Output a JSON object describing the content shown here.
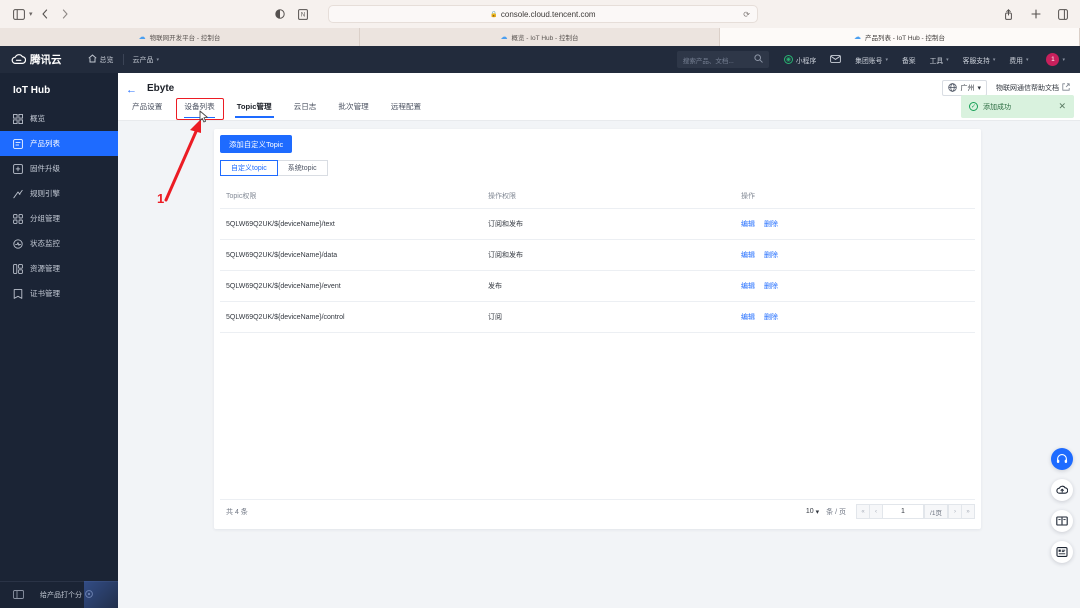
{
  "browser": {
    "url": "console.cloud.tencent.com",
    "lock_icon": "lock-icon",
    "reload_icon": "reload-icon",
    "sidebar_toggle_icon": "sidebar-toggle-icon",
    "back_icon": "back-icon",
    "forward_icon": "forward-icon",
    "reader_icon": "reader-icon",
    "extension_icon": "notion-extension-icon",
    "share_icon": "share-icon",
    "newtab_icon": "new-tab-icon",
    "tabs_icon": "show-tabs-icon",
    "tabs": [
      {
        "title": "物联网开发平台 - 控制台",
        "active": false
      },
      {
        "title": "概览 - IoT Hub - 控制台",
        "active": false
      },
      {
        "title": "产品列表 - IoT Hub - 控制台",
        "active": true
      }
    ]
  },
  "tc_header": {
    "logo_text": "腾讯云",
    "nav": [
      {
        "label": "总览",
        "icon": "home-icon",
        "caret": false
      },
      {
        "label": "云产品",
        "icon": "",
        "caret": true
      }
    ],
    "search_placeholder": "搜索产品、文档...",
    "right_items": [
      {
        "label": "小程序",
        "icon": "miniprogram-icon",
        "caret": false
      },
      {
        "label": "",
        "icon": "mail-icon",
        "caret": false
      },
      {
        "label": "集团账号",
        "icon": "",
        "caret": true
      },
      {
        "label": "备案",
        "icon": "",
        "caret": false
      },
      {
        "label": "工具",
        "icon": "",
        "caret": true
      },
      {
        "label": "客服支持",
        "icon": "",
        "caret": true
      },
      {
        "label": "费用",
        "icon": "",
        "caret": true
      }
    ],
    "avatar_text": "1"
  },
  "sidebar": {
    "title": "IoT Hub",
    "items": [
      {
        "label": "概览",
        "icon": "grid-icon",
        "active": false
      },
      {
        "label": "产品列表",
        "icon": "product-list-icon",
        "active": true
      },
      {
        "label": "固件升级",
        "icon": "firmware-upgrade-icon",
        "active": false
      },
      {
        "label": "规则引擎",
        "icon": "rule-engine-icon",
        "active": false
      },
      {
        "label": "分组管理",
        "icon": "group-manage-icon",
        "active": false
      },
      {
        "label": "状态监控",
        "icon": "status-monitor-icon",
        "active": false
      },
      {
        "label": "资源管理",
        "icon": "resource-manage-icon",
        "active": false
      },
      {
        "label": "证书管理",
        "icon": "certificate-icon",
        "active": false
      }
    ],
    "footer": {
      "collapse_icon": "collapse-icon",
      "rate_label": "给产品打个分",
      "rate_icon": "star-circle-icon"
    }
  },
  "page": {
    "back_icon": "back-arrow-icon",
    "title": "Ebyte",
    "tabs": [
      {
        "label": "产品设置",
        "state": "normal"
      },
      {
        "label": "设备列表",
        "state": "hovered"
      },
      {
        "label": "Topic管理",
        "state": "active"
      },
      {
        "label": "云日志",
        "state": "normal"
      },
      {
        "label": "批次管理",
        "state": "normal"
      },
      {
        "label": "远程配置",
        "state": "normal"
      }
    ],
    "region": {
      "label": "广州",
      "icon": "globe-icon",
      "caret": "▾"
    },
    "help_link": "物联网通信帮助文档",
    "help_external_icon": "external-link-icon"
  },
  "toast": {
    "icon": "success-check-icon",
    "message": "添加成功",
    "close_icon": "close-icon"
  },
  "panel": {
    "add_button": "添加自定义Topic",
    "segments": [
      {
        "label": "自定义topic",
        "active": true
      },
      {
        "label": "系统topic",
        "active": false
      }
    ],
    "columns": [
      "Topic权限",
      "操作权限",
      "操作"
    ],
    "rows": [
      {
        "topic": "5QLW69Q2UK/${deviceName}/text",
        "permission": "订阅和发布",
        "actions": [
          "编辑",
          "删除"
        ]
      },
      {
        "topic": "5QLW69Q2UK/${deviceName}/data",
        "permission": "订阅和发布",
        "actions": [
          "编辑",
          "删除"
        ]
      },
      {
        "topic": "5QLW69Q2UK/${deviceName}/event",
        "permission": "发布",
        "actions": [
          "编辑",
          "删除"
        ]
      },
      {
        "topic": "5QLW69Q2UK/${deviceName}/control",
        "permission": "订阅",
        "actions": [
          "编辑",
          "删除"
        ]
      }
    ],
    "footer": {
      "total": "共 4 条",
      "page_size": "10",
      "page_size_caret": "▾",
      "page_size_unit": "条 / 页",
      "first_icon": "«",
      "prev_icon": "‹",
      "current_page": "1",
      "total_pages": "/1页",
      "next_icon": "›",
      "last_icon": "»"
    }
  },
  "fabs": [
    {
      "icon": "headset-support-icon",
      "primary": true
    },
    {
      "icon": "cloud-upload-icon",
      "primary": false
    },
    {
      "icon": "documentation-book-icon",
      "primary": false
    },
    {
      "icon": "task-list-icon",
      "primary": false
    }
  ],
  "annotation": {
    "number": "1",
    "arrow_color": "#ec1c24",
    "box_color": "#ec1c24"
  },
  "colors": {
    "accent": "#1e6bff",
    "sidebar_bg": "#1b2435",
    "header_bg": "#222b3c",
    "success": "#18a058",
    "annotation": "#ec1c24"
  }
}
